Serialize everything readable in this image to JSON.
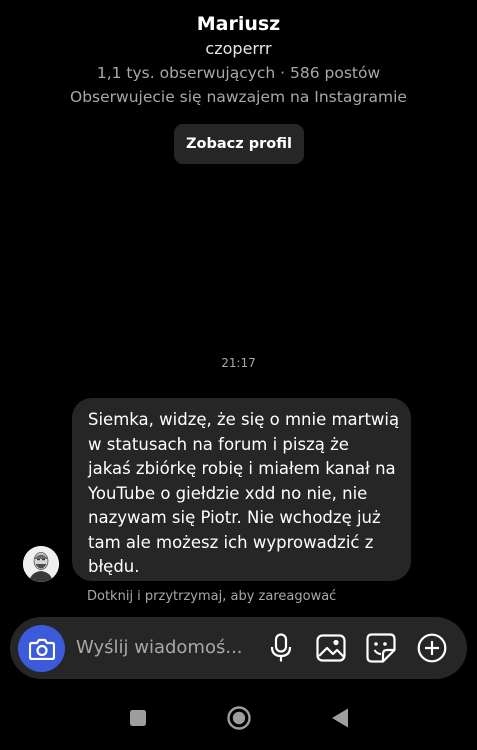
{
  "profile": {
    "name": "Mariusz",
    "username": "czoperrr",
    "stats": "1,1 tys. obserwujących · 586 postów",
    "mutual": "Obserwujecie się nawzajem na Instagramie",
    "view_profile_label": "Zobacz profil"
  },
  "chat": {
    "timestamp": "21:17",
    "message_lines": [
      "Siemka, widzę, że się o mnie martwią",
      "w statusach na forum i piszą że",
      "jakaś zbiórkę robię i miałem kanał na",
      "YouTube o giełdzie xdd no nie, nie",
      "nazywam się Piotr. Nie wchodzę już",
      "tam ale możesz ich wyprowadzić z",
      "błędu."
    ],
    "react_hint": "Dotknij i przytrzymaj, aby zareagować"
  },
  "composer": {
    "placeholder": "Wyślij wiadomoś...",
    "icons": [
      "camera-icon",
      "microphone-icon",
      "image-icon",
      "sticker-icon",
      "plus-icon"
    ],
    "camera_color": "#3b5bdb"
  },
  "system_nav": {
    "icons": [
      "recent-apps-icon",
      "home-icon",
      "back-icon"
    ]
  }
}
